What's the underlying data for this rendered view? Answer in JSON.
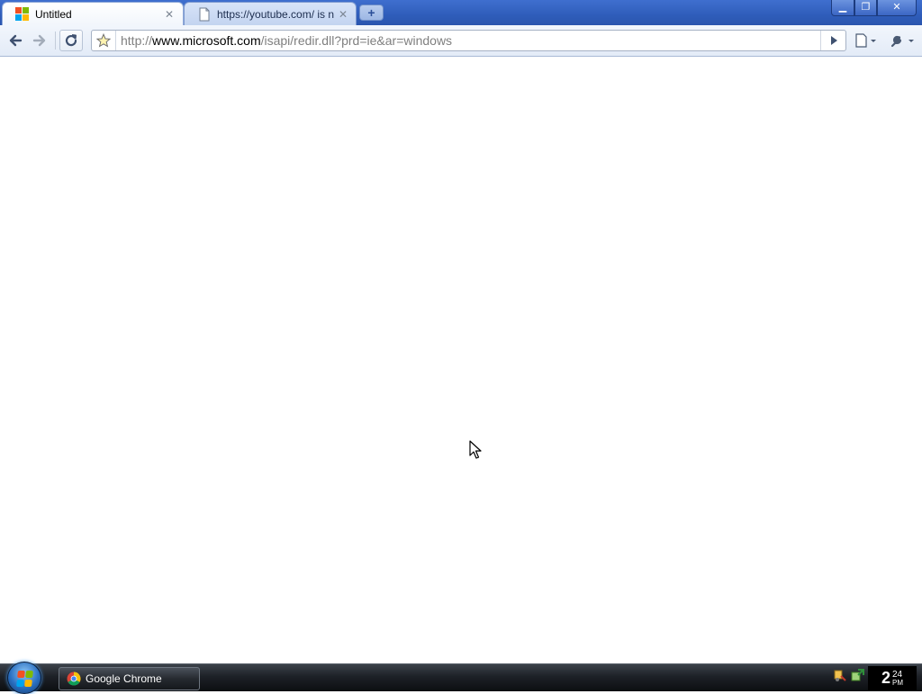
{
  "browser": {
    "tabs": [
      {
        "title": "Untitled",
        "active": true,
        "favicon": "windows-logo-icon"
      },
      {
        "title": "https://youtube.com/ is not ...",
        "active": false,
        "favicon": "page-icon"
      }
    ],
    "new_tab_icon": "plus-icon",
    "window_controls": [
      "minimize-icon",
      "restore-icon",
      "close-icon"
    ]
  },
  "toolbar": {
    "back_icon": "back-arrow-icon",
    "forward_icon": "forward-arrow-icon",
    "reload_icon": "reload-icon",
    "star_icon": "star-icon",
    "url": {
      "prefix": "http://",
      "domain": "www.microsoft.com",
      "path": "/isapi/redir.dll?prd=ie&ar=windows"
    },
    "go_icon": "go-arrow-icon",
    "page_menu_icon": "page-menu-icon",
    "tools_menu_icon": "wrench-icon"
  },
  "taskbar": {
    "start_icon": "start-orb-icon",
    "items": [
      {
        "label": "Google Chrome",
        "icon": "chrome-icon"
      }
    ],
    "tray_icons": [
      "network-tools-icon",
      "update-icon"
    ],
    "clock": {
      "hour": "2",
      "minute": "24",
      "ampm": "PM"
    }
  },
  "colors": {
    "titlebar_blue": "#2f5dba",
    "toolbar_bg": "#e3ebf7",
    "taskbar_bg": "#1d2127"
  }
}
